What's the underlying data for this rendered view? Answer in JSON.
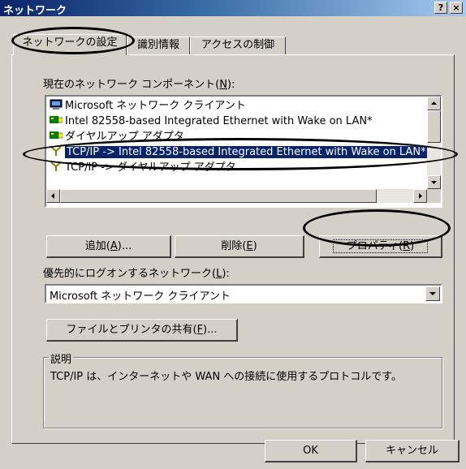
{
  "window": {
    "title": "ネットワーク",
    "help_glyph": "?",
    "close_glyph": "×"
  },
  "tabs": [
    {
      "label": "ネットワークの設定",
      "active": true
    },
    {
      "label": "識別情報",
      "active": false
    },
    {
      "label": "アクセスの制御",
      "active": false
    }
  ],
  "components": {
    "label": "現在のネットワーク コンポーネント",
    "mnemonic": "N",
    "items": [
      {
        "icon": "network-client-icon",
        "text": "Microsoft ネットワーク クライアント",
        "selected": false
      },
      {
        "icon": "network-adapter-icon",
        "text": "Intel 82558-based Integrated Ethernet with Wake on LAN*",
        "selected": false
      },
      {
        "icon": "network-adapter-icon",
        "text": "ダイヤルアップ アダプタ",
        "selected": false
      },
      {
        "icon": "protocol-icon",
        "text": "TCP/IP -> Intel 82558-based Integrated Ethernet with Wake on LAN*",
        "selected": true
      },
      {
        "icon": "protocol-icon",
        "text": "TCP/IP -> ダイヤルアップ アダプタ",
        "selected": false
      }
    ]
  },
  "buttons": {
    "add": {
      "label": "追加",
      "mnemonic": "A",
      "suffix": "..."
    },
    "remove": {
      "label": "削除",
      "mnemonic": "E",
      "suffix": ""
    },
    "properties": {
      "label": "プロパティ",
      "mnemonic": "R",
      "suffix": ""
    }
  },
  "logon": {
    "label": "優先的にログオンするネットワーク",
    "mnemonic": "L",
    "value": "Microsoft ネットワーク クライアント"
  },
  "share": {
    "label": "ファイルとプリンタの共有",
    "mnemonic": "F",
    "suffix": "..."
  },
  "description": {
    "legend": "説明",
    "text": "TCP/IP は、インターネットや WAN への接続に使用するプロトコルです。"
  },
  "footer": {
    "ok": "OK",
    "cancel": "キャンセル"
  }
}
